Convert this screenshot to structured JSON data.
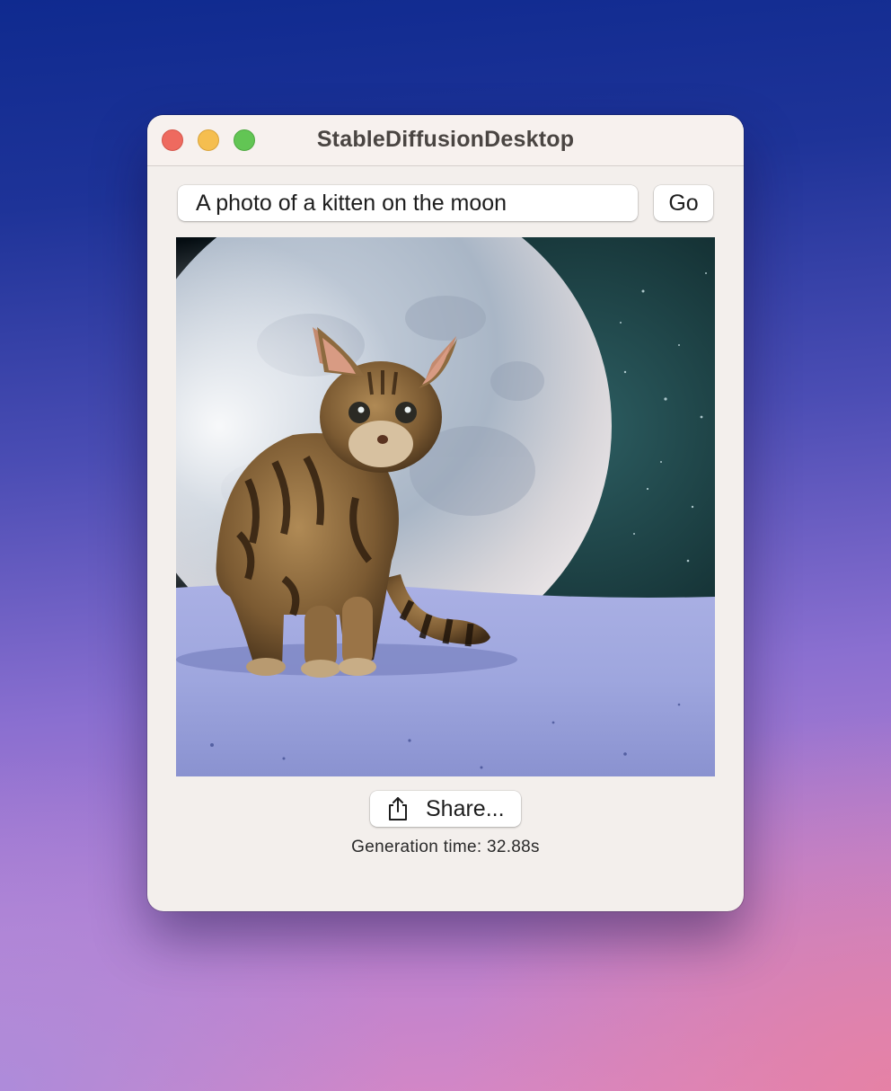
{
  "window": {
    "title": "StableDiffusionDesktop"
  },
  "prompt": {
    "value": "A photo of a kitten on the moon"
  },
  "go_button": {
    "label": "Go"
  },
  "generated_image": {
    "alt": "A photo of a kitten on the moon",
    "icon": "image"
  },
  "share_button": {
    "label": "Share...",
    "icon": "share-icon"
  },
  "status": {
    "generation_time": "Generation time: 32.88s"
  },
  "colors": {
    "close": "#ee6a5f",
    "minimize": "#f5be4f",
    "maximize": "#62c554",
    "window_bg": "#f3efec"
  }
}
